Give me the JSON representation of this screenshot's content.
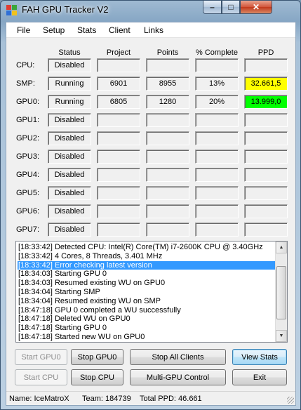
{
  "window": {
    "title": "FAH GPU Tracker V2",
    "min_glyph": "–",
    "max_glyph": "□",
    "close_glyph": "✕"
  },
  "menu": [
    "File",
    "Setup",
    "Stats",
    "Client",
    "Links"
  ],
  "columns": [
    "Status",
    "Project",
    "Points",
    "% Complete",
    "PPD"
  ],
  "rows": [
    {
      "label": "CPU:",
      "status": "Disabled",
      "project": "",
      "points": "",
      "complete": "",
      "ppd": ""
    },
    {
      "label": "SMP:",
      "status": "Running",
      "project": "6901",
      "points": "8955",
      "complete": "13%",
      "ppd": "32.661,5",
      "ppd_color": "#ffff00"
    },
    {
      "label": "GPU0:",
      "status": "Running",
      "project": "6805",
      "points": "1280",
      "complete": "20%",
      "ppd": "13.999,0",
      "ppd_color": "#00ff00"
    },
    {
      "label": "GPU1:",
      "status": "Disabled",
      "project": "",
      "points": "",
      "complete": "",
      "ppd": ""
    },
    {
      "label": "GPU2:",
      "status": "Disabled",
      "project": "",
      "points": "",
      "complete": "",
      "ppd": ""
    },
    {
      "label": "GPU3:",
      "status": "Disabled",
      "project": "",
      "points": "",
      "complete": "",
      "ppd": ""
    },
    {
      "label": "GPU4:",
      "status": "Disabled",
      "project": "",
      "points": "",
      "complete": "",
      "ppd": ""
    },
    {
      "label": "GPU5:",
      "status": "Disabled",
      "project": "",
      "points": "",
      "complete": "",
      "ppd": ""
    },
    {
      "label": "GPU6:",
      "status": "Disabled",
      "project": "",
      "points": "",
      "complete": "",
      "ppd": ""
    },
    {
      "label": "GPU7:",
      "status": "Disabled",
      "project": "",
      "points": "",
      "complete": "",
      "ppd": ""
    }
  ],
  "log": [
    "[18:33:42] Detected CPU: Intel(R) Core(TM) i7-2600K CPU @ 3.40GHz",
    "[18:33:42] 4 Cores, 8 Threads, 3.401 MHz",
    "[18:33:42] Error checking latest version",
    "[18:34:03] Starting GPU 0",
    "[18:34:03] Resumed existing WU on GPU0",
    "[18:34:04] Starting SMP",
    "[18:34:04] Resumed existing WU on SMP",
    "[18:47:18] GPU 0 completed a WU successfully",
    "[18:47:18] Deleted WU on GPU0",
    "[18:47:18] Starting GPU 0",
    "[18:47:18] Started new WU on GPU0"
  ],
  "log_selected_index": 2,
  "log_scroll_fraction": 0.55,
  "buttons": {
    "start_gpu0": "Start GPU0",
    "stop_gpu0": "Stop GPU0",
    "stop_all": "Stop All Clients",
    "view_stats": "View Stats",
    "start_cpu": "Start CPU",
    "stop_cpu": "Stop CPU",
    "multi_gpu": "Multi-GPU Control",
    "exit": "Exit"
  },
  "status": {
    "name": "Name: IceMatroX",
    "team": "Team: 184739",
    "total_ppd": "Total PPD: 46.661"
  }
}
